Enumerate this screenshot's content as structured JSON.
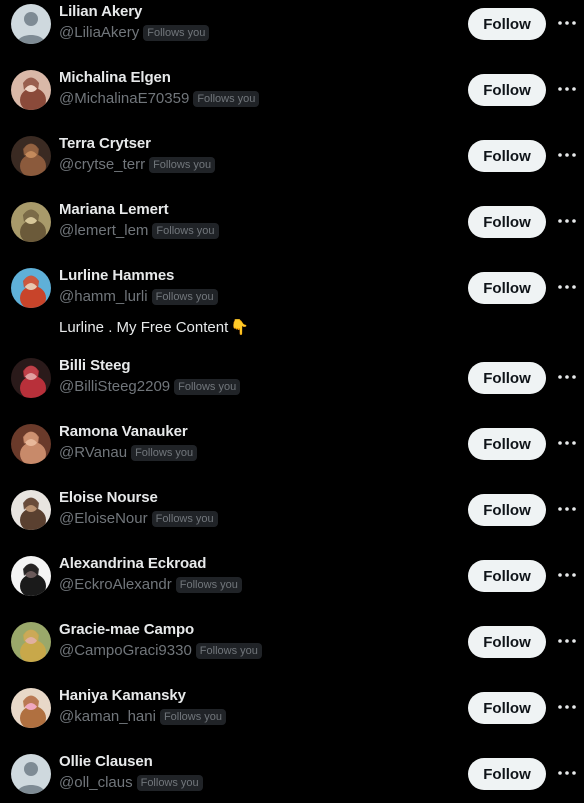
{
  "colors": {
    "background": "#000000",
    "name_text": "#e7e9ea",
    "handle_text": "#71767b",
    "badge_bg": "#202327",
    "follow_button_bg": "#eff3f4",
    "follow_button_text": "#0f1419"
  },
  "follow_label": "Follow",
  "follows_you_label": "Follows you",
  "more_icon": "more-horizontal-icon",
  "users": [
    {
      "name": "Lilian Akery",
      "handle": "@LiliaAkery",
      "follows_you": true,
      "avatar": "default-avatar"
    },
    {
      "name": "Michalina Elgen",
      "handle": "@MichalinaE70359",
      "follows_you": true,
      "avatar": "photo"
    },
    {
      "name": "Terra Crytser",
      "handle": "@crytse_terr",
      "follows_you": true,
      "avatar": "photo"
    },
    {
      "name": "Mariana Lemert",
      "handle": "@lemert_lem",
      "follows_you": true,
      "avatar": "photo"
    },
    {
      "name": "Lurline Hammes",
      "handle": "@hamm_lurli",
      "follows_you": true,
      "avatar": "photo",
      "bio": "Lurline . My Free Content",
      "bio_emoji": "👇"
    },
    {
      "name": "Billi Steeg",
      "handle": "@BilliSteeg2209",
      "follows_you": true,
      "avatar": "photo"
    },
    {
      "name": "Ramona Vanauker",
      "handle": "@RVanau",
      "follows_you": true,
      "avatar": "photo"
    },
    {
      "name": "Eloise Nourse",
      "handle": "@EloiseNour",
      "follows_you": true,
      "avatar": "photo"
    },
    {
      "name": "Alexandrina Eckroad",
      "handle": "@EckroAlexandr",
      "follows_you": true,
      "avatar": "photo"
    },
    {
      "name": "Gracie-mae Campo",
      "handle": "@CampoGraci9330",
      "follows_you": true,
      "avatar": "photo"
    },
    {
      "name": "Haniya Kamansky",
      "handle": "@kaman_hani",
      "follows_you": true,
      "avatar": "photo"
    },
    {
      "name": "Ollie Clausen",
      "handle": "@oll_claus",
      "follows_you": true,
      "avatar": "default-avatar"
    }
  ]
}
